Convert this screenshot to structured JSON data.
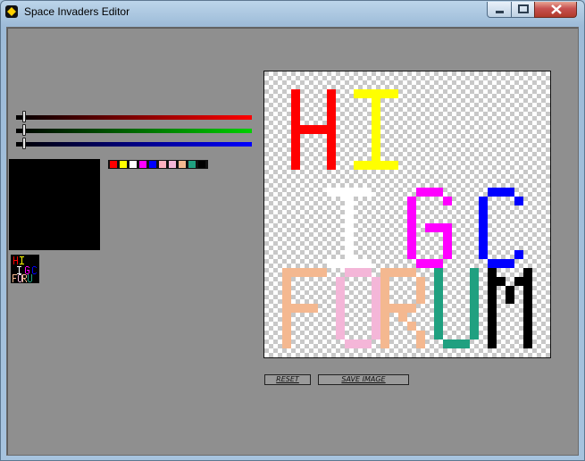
{
  "window": {
    "title": "Space Invaders Editor"
  },
  "sliders": [
    {
      "channel": "red",
      "color": "#ff0000",
      "value": 0
    },
    {
      "channel": "green",
      "color": "#00d000",
      "value": 0
    },
    {
      "channel": "blue",
      "color": "#0000ff",
      "value": 0
    }
  ],
  "current_color": "#000000",
  "palette": [
    "#ff0000",
    "#ffff00",
    "#ffffff",
    "#ff00ff",
    "#0000ff",
    "#ffb0c0",
    "#f4b6d8",
    "#f4b890",
    "#20a080",
    "#000000"
  ],
  "buttons": {
    "reset_label": "RESET",
    "save_label": "SAVE IMAGE"
  },
  "canvas": {
    "letters": [
      {
        "char": "H",
        "color": "#ff0000"
      },
      {
        "char": "I",
        "color": "#ffff00"
      },
      {
        "char": "I",
        "color": "#ffffff"
      },
      {
        "char": "G",
        "color": "#ff00ff"
      },
      {
        "char": "C",
        "color": "#0000ff"
      },
      {
        "char": "F",
        "color": "#f4b890"
      },
      {
        "char": "O",
        "color": "#f4b6d8"
      },
      {
        "char": "R",
        "color": "#f4b890"
      },
      {
        "char": "U",
        "color": "#20a080"
      },
      {
        "char": "M",
        "color": "#000000"
      }
    ]
  }
}
